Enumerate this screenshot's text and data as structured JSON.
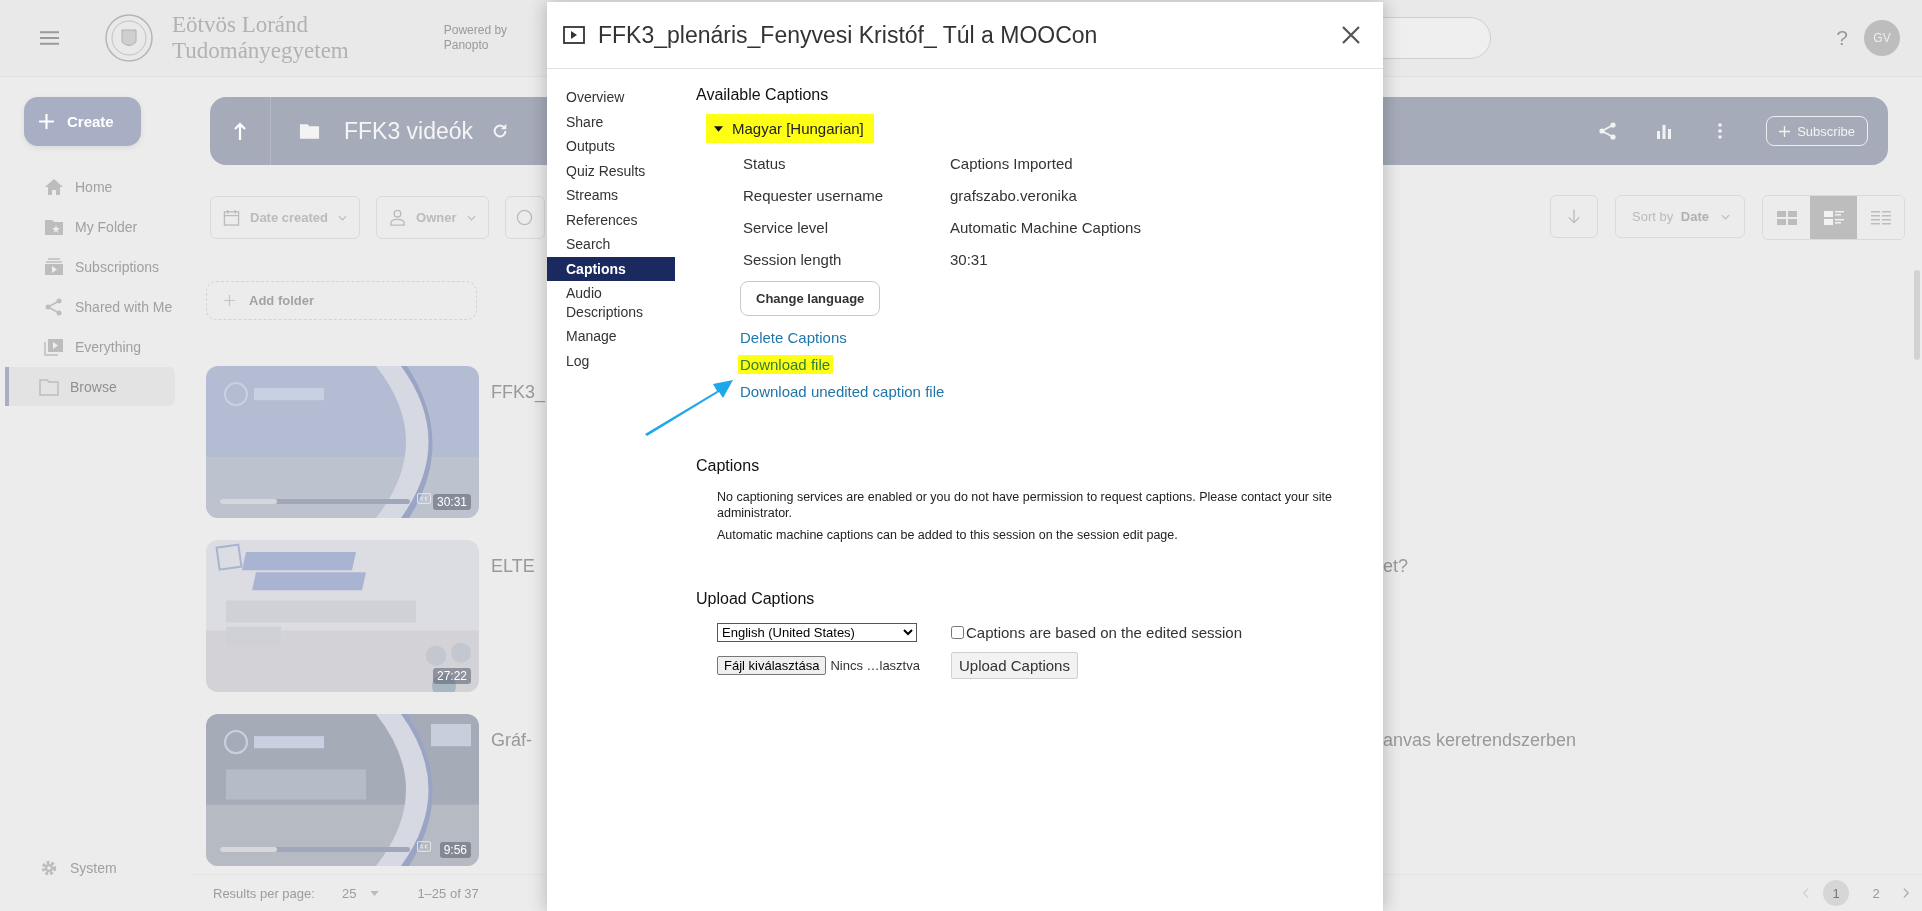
{
  "header": {
    "university_name": [
      "Eötvös Loránd",
      "Tudományegyetem"
    ],
    "powered_by": [
      "Powered by",
      "Panopto"
    ],
    "help": "?",
    "avatar": "GV"
  },
  "sidebar": {
    "create": "Create",
    "items": [
      {
        "label": "Home",
        "selected": false
      },
      {
        "label": "My Folder",
        "selected": false
      },
      {
        "label": "Subscriptions",
        "selected": false
      },
      {
        "label": "Shared with Me",
        "selected": false
      },
      {
        "label": "Everything",
        "selected": false
      },
      {
        "label": "Browse",
        "selected": true
      }
    ],
    "system": "System"
  },
  "folder_bar": {
    "title": "FFK3 videók",
    "subscribe": "Subscribe"
  },
  "filters": [
    {
      "label": "Date created"
    },
    {
      "label": "Owner"
    }
  ],
  "sort": {
    "prefix": "Sort by",
    "value": "Date"
  },
  "view_modes": [
    {
      "kind": "tiles",
      "selected": false
    },
    {
      "kind": "detail",
      "selected": true
    },
    {
      "kind": "list",
      "selected": false
    }
  ],
  "add_folder": "Add folder",
  "sessions": [
    {
      "title_start": "FFK3_",
      "duration": "30:31",
      "captions": true,
      "level": 0.3
    },
    {
      "title_start": "ELTE",
      "title_end": "et?",
      "duration": "27:22",
      "captions": false
    },
    {
      "title_start": "Gráf-",
      "title_end": "anvas keretrendszerben",
      "duration": "9:56",
      "captions": true,
      "level": 0.3
    }
  ],
  "pagination": {
    "results_label": "Results per page:",
    "per_page": "25",
    "range": "1–25 of 37",
    "pages": [
      {
        "label": "1",
        "selected": true
      },
      {
        "label": "2",
        "selected": false
      }
    ]
  },
  "modal": {
    "title": "FFK3_plenáris_Fenyvesi Kristóf_ Túl a MOOCon",
    "nav": [
      {
        "label": "Overview",
        "selected": false
      },
      {
        "label": "Share",
        "selected": false
      },
      {
        "label": "Outputs",
        "selected": false
      },
      {
        "label": "Quiz Results",
        "selected": false
      },
      {
        "label": "Streams",
        "selected": false
      },
      {
        "label": "References",
        "selected": false
      },
      {
        "label": "Search",
        "selected": false
      },
      {
        "label": "Captions",
        "selected": true
      },
      {
        "label": "Audio Descriptions",
        "selected": false
      },
      {
        "label": "Manage",
        "selected": false
      },
      {
        "label": "Log",
        "selected": false
      }
    ],
    "available": {
      "heading": "Available Captions",
      "language": {
        "label": "Magyar [Hungarian]",
        "expanded": true,
        "highlighted": true
      },
      "details": [
        {
          "label": "Status",
          "value": "Captions Imported"
        },
        {
          "label": "Requester username",
          "value": "grafszabo.veronika"
        },
        {
          "label": "Service level",
          "value": "Automatic Machine Captions"
        },
        {
          "label": "Session length",
          "value": "30:31"
        }
      ],
      "change_language": "Change language",
      "links": [
        {
          "label": "Delete Captions",
          "highlighted": false
        },
        {
          "label": "Download file",
          "highlighted": true
        },
        {
          "label": "Download unedited caption file",
          "highlighted": false
        }
      ]
    },
    "captions": {
      "heading": "Captions",
      "notes": [
        "No captioning services are enabled or you do not have permission to request captions. Please contact your site administrator.",
        "Automatic machine captions can be added to this session on the session edit page."
      ]
    },
    "upload": {
      "heading": "Upload Captions",
      "language": "English (United States)",
      "file_button": "Fájl kiválasztása",
      "file_status": "Nincs …lasztva",
      "edited_checkbox": {
        "label": "Captions are based on the edited session",
        "checked": false
      },
      "button": "Upload Captions"
    }
  }
}
